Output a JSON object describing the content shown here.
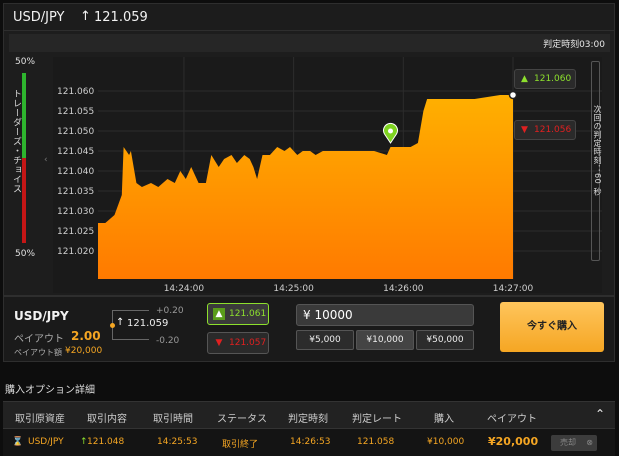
{
  "header": {
    "pair": "USD/JPY",
    "arrow": "↑",
    "price": "121.059"
  },
  "chart": {
    "judge_time": "判定時刻03:00",
    "sentiment_top": "50%",
    "sentiment_bottom": "50%",
    "sentiment_label": "トレーダーズ・チョイス",
    "next_judge_label": "次回の判定時刻：60 秒",
    "high_button": "121.060",
    "low_button": "121.056",
    "colors": {
      "area_top": "#ffb000",
      "area_bottom": "#ff7a00",
      "up": "#8de02d",
      "down": "#e02020"
    }
  },
  "chart_data": {
    "type": "area",
    "ylim": [
      121.013,
      121.066
    ],
    "yticks": [
      "121.060",
      "121.055",
      "121.050",
      "121.045",
      "121.040",
      "121.035",
      "121.030",
      "121.025",
      "121.020"
    ],
    "xticks": [
      "14:24:00",
      "14:25:00",
      "14:26:00",
      "14:27:00"
    ],
    "x": [
      "14:23:13",
      "14:23:17",
      "14:23:22",
      "14:23:26",
      "14:23:27",
      "14:23:30",
      "14:23:31",
      "14:23:34",
      "14:23:37",
      "14:23:42",
      "14:23:46",
      "14:23:51",
      "14:23:55",
      "14:23:58",
      "14:24:01",
      "14:24:04",
      "14:24:08",
      "14:24:12",
      "14:24:15",
      "14:24:19",
      "14:24:22",
      "14:24:26",
      "14:24:29",
      "14:24:33",
      "14:24:36",
      "14:24:38",
      "14:24:40",
      "14:24:43",
      "14:24:47",
      "14:24:51",
      "14:24:55",
      "14:24:58",
      "14:25:02",
      "14:25:05",
      "14:25:09",
      "14:25:12",
      "14:25:16",
      "14:25:23",
      "14:25:30",
      "14:25:37",
      "14:25:44",
      "14:25:51",
      "14:25:53",
      "14:25:57",
      "14:26:04",
      "14:26:08",
      "14:26:11",
      "14:26:13",
      "14:26:25",
      "14:26:39",
      "14:26:53",
      "14:27:00"
    ],
    "values": [
      121.027,
      121.027,
      121.029,
      121.034,
      121.046,
      121.044,
      121.045,
      121.037,
      121.036,
      121.037,
      121.036,
      121.038,
      121.037,
      121.04,
      121.038,
      121.041,
      121.037,
      121.037,
      121.044,
      121.041,
      121.043,
      121.044,
      121.042,
      121.044,
      121.043,
      121.041,
      121.038,
      121.044,
      121.044,
      121.046,
      121.045,
      121.046,
      121.044,
      121.045,
      121.045,
      121.044,
      121.045,
      121.045,
      121.045,
      121.045,
      121.045,
      121.044,
      121.046,
      121.046,
      121.046,
      121.047,
      121.055,
      121.058,
      121.058,
      121.058,
      121.059,
      121.059
    ],
    "entry": {
      "x": "14:25:53",
      "y": 121.048
    }
  },
  "order": {
    "pair": "USD/JPY",
    "payout_label": "ペイアウト",
    "payout_value": "2.00",
    "payout_amount_label": "ペイアウト額",
    "payout_amount": "¥20,000",
    "current_price": "121.059",
    "plus": "+0.20",
    "minus": "-0.20",
    "high_value": "121.061",
    "low_value": "121.057",
    "amount": "¥ 10000",
    "presets": [
      "¥5,000",
      "¥10,000",
      "¥50,000"
    ],
    "buy_label": "今すぐ購入"
  },
  "details": {
    "title": "購入オプション詳細",
    "columns": [
      "取引原資産",
      "取引内容",
      "取引時間",
      "ステータス",
      "判定時刻",
      "判定レート",
      "購入",
      "ペイアウト"
    ],
    "row": {
      "asset": "USD/JPY",
      "direction": "121.048",
      "time": "14:25:53",
      "status": "取引終了",
      "judge_time": "14:26:53",
      "judge_rate": "121.058",
      "purchase": "¥10,000",
      "payout": "¥20,000",
      "close": "売却"
    }
  }
}
